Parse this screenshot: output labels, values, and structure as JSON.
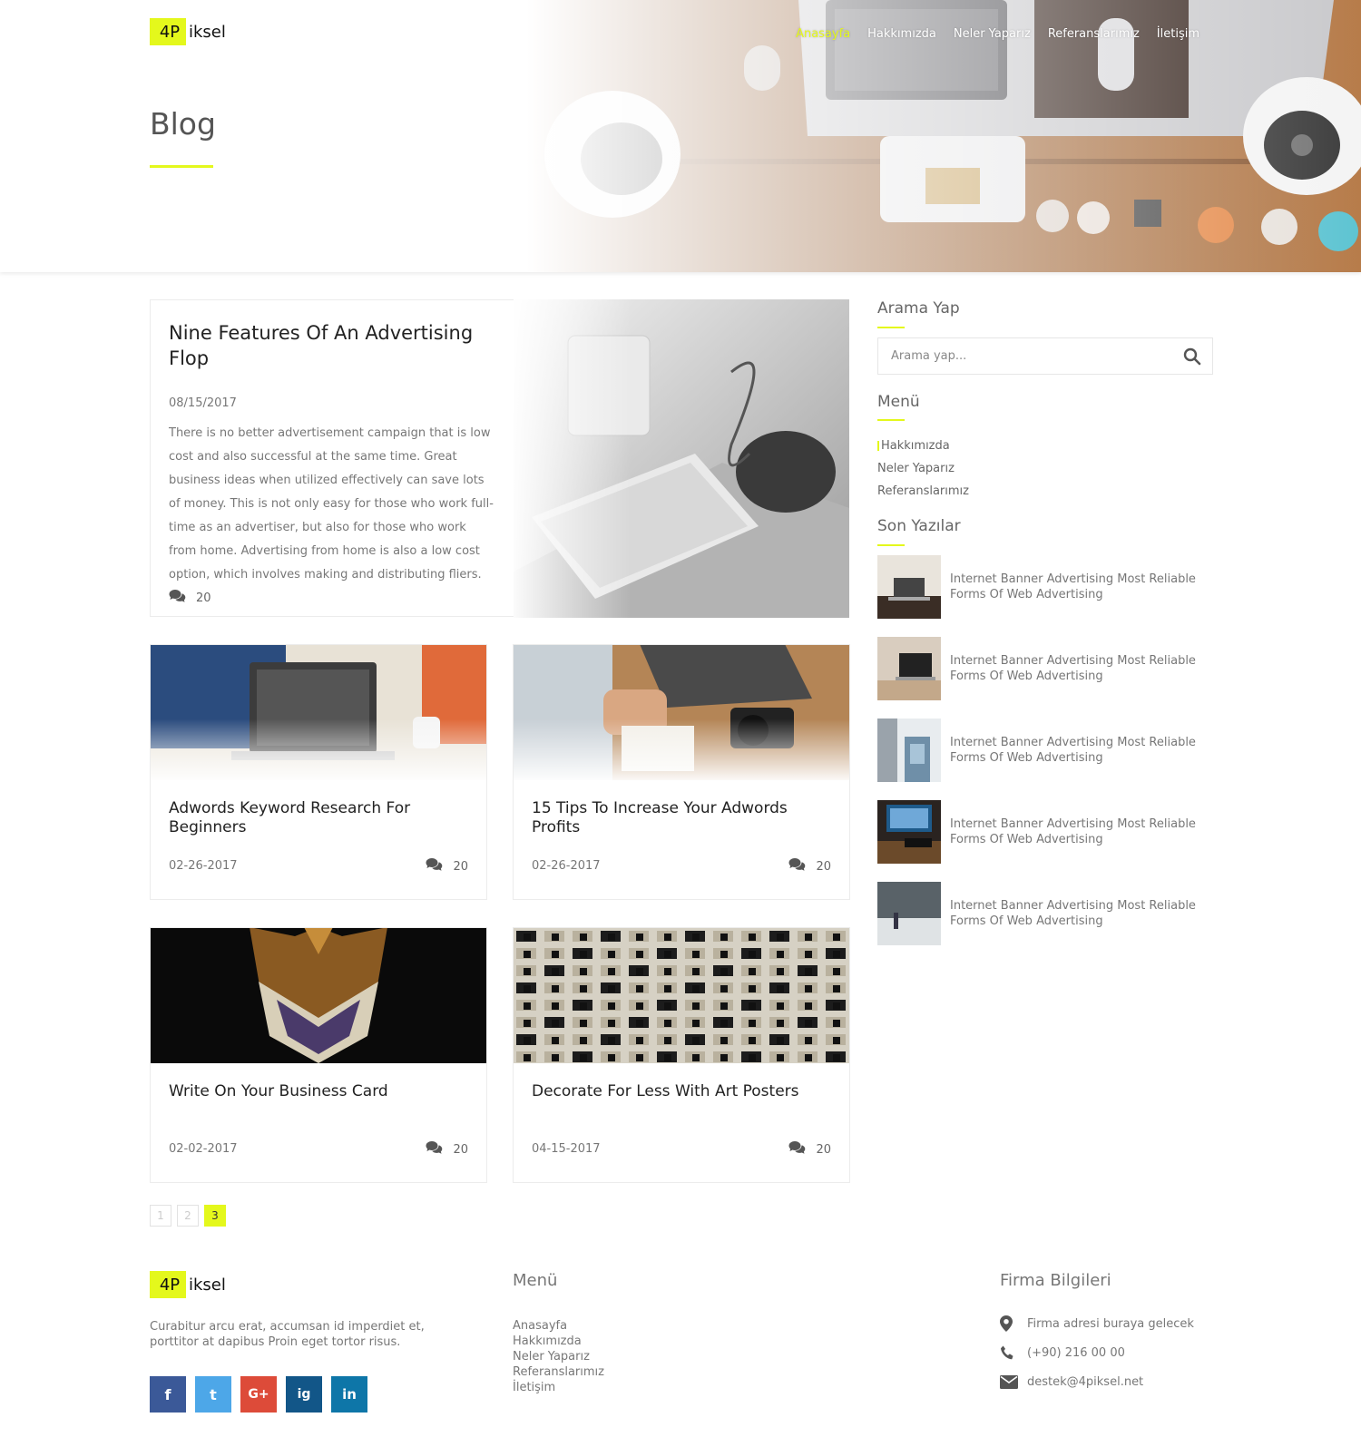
{
  "brand": {
    "logo_mark": "4P",
    "logo_rest": "iksel",
    "accent_color": "#e4f81c"
  },
  "nav": {
    "items": [
      {
        "label": "Anasayfa",
        "active": true
      },
      {
        "label": "Hakkımızda"
      },
      {
        "label": "Neler Yaparız"
      },
      {
        "label": "Referanslarımız"
      },
      {
        "label": "İletişim"
      }
    ]
  },
  "page": {
    "title": "Blog"
  },
  "featured": {
    "title": "Nine Features Of An Advertising Flop",
    "date": "08/15/2017",
    "excerpt": "There is no better advertisement campaign that is low cost and also successful at the same time. Great business ideas when utilized effectively can save lots of money. This is not only easy for those who work full-time as an advertiser, but also for those who work from home. Advertising from home is also a low cost option, which involves making and distributing fliers.",
    "comments": "20",
    "comment_icon": "comments-icon"
  },
  "posts": [
    {
      "title": "Adwords Keyword Research For Beginners",
      "date": "02-26-2017",
      "comments": "20"
    },
    {
      "title": "15 Tips To Increase Your Adwords Profits",
      "date": "02-26-2017",
      "comments": "20"
    },
    {
      "title": "Write On Your Business Card",
      "date": "02-02-2017",
      "comments": "20"
    },
    {
      "title": "Decorate For Less With Art Posters",
      "date": "04-15-2017",
      "comments": "20"
    }
  ],
  "pagination": {
    "pages": [
      "1",
      "2",
      "3"
    ],
    "current": "3"
  },
  "sidebar": {
    "search": {
      "heading": "Arama Yap",
      "placeholder": "Arama yap...",
      "icon": "search-icon"
    },
    "menu": {
      "heading": "Menü",
      "items": [
        "Hakkımızda",
        "Neler Yaparız",
        "Referanslarımız"
      ]
    },
    "recent": {
      "heading": "Son Yazılar",
      "items": [
        "Internet Banner Advertising Most Reliable Forms Of Web Advertising",
        "Internet Banner Advertising Most Reliable Forms Of Web Advertising",
        "Internet Banner Advertising Most Reliable Forms Of Web Advertising",
        "Internet Banner Advertising Most Reliable Forms Of Web Advertising",
        "Internet Banner Advertising Most Reliable Forms Of Web Advertising"
      ]
    }
  },
  "footer": {
    "about": "Curabitur arcu erat, accumsan id imperdiet et, porttitor at dapibus Proin eget tortor risus.",
    "socials": [
      {
        "name": "facebook",
        "glyph": "f",
        "color": "#3b5998"
      },
      {
        "name": "twitter",
        "glyph": "t",
        "color": "#4da7e8"
      },
      {
        "name": "google-plus",
        "glyph": "G+",
        "color": "#dd4b39"
      },
      {
        "name": "instagram",
        "glyph": "ig",
        "color": "#125688"
      },
      {
        "name": "linkedin",
        "glyph": "in",
        "color": "#0e76a8"
      }
    ],
    "menu": {
      "heading": "Menü",
      "items": [
        "Anasayfa",
        "Hakkımızda",
        "Neler Yaparız",
        "Referanslarımız",
        "İletişim"
      ]
    },
    "company": {
      "heading": "Firma Bilgileri",
      "address": "Firma adresi buraya gelecek",
      "phone": "(+90) 216 00 00",
      "email": "destek@4piksel.net"
    }
  }
}
